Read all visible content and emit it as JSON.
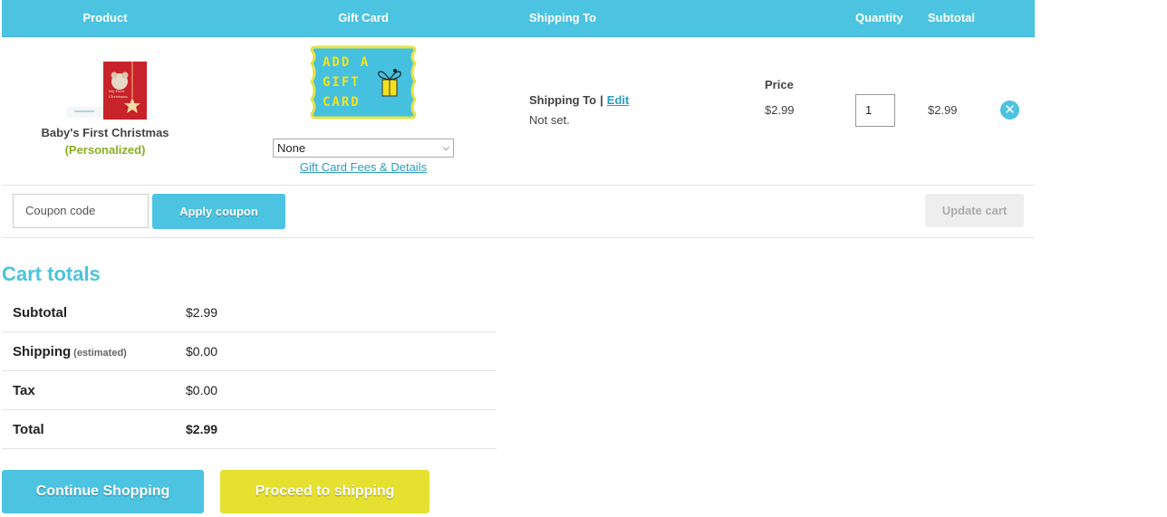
{
  "table": {
    "headers": {
      "product": "Product",
      "gift_card": "Gift Card",
      "shipping_to": "Shipping To",
      "price": "Price",
      "quantity": "Quantity",
      "subtotal": "Subtotal"
    }
  },
  "item": {
    "name": "Baby's First Christmas",
    "note": "(Personalized)",
    "gift_card_image_text": "ADD A GIFT CARD",
    "gift_card_option": "None",
    "gift_card_link": "Gift Card Fees & Details",
    "shipping_label": "Shipping To",
    "shipping_separator": "|",
    "shipping_edit": "Edit",
    "shipping_value": "Not set.",
    "price": "$2.99",
    "quantity": "1",
    "subtotal": "$2.99",
    "remove_icon": "close-circle-icon"
  },
  "actions": {
    "coupon_placeholder": "Coupon code",
    "apply_coupon": "Apply coupon",
    "update_cart": "Update cart"
  },
  "totals": {
    "title": "Cart totals",
    "subtotal_label": "Subtotal",
    "subtotal_value": "$2.99",
    "shipping_label": "Shipping",
    "shipping_note": "(estimated)",
    "shipping_value": "$0.00",
    "tax_label": "Tax",
    "tax_value": "$0.00",
    "total_label": "Total",
    "total_value": "$2.99"
  },
  "buttons": {
    "continue": "Continue Shopping",
    "proceed": "Proceed to shipping"
  },
  "colors": {
    "accent": "#4cc3e0",
    "proceed": "#e6e030",
    "personalized": "#8aae1e"
  }
}
